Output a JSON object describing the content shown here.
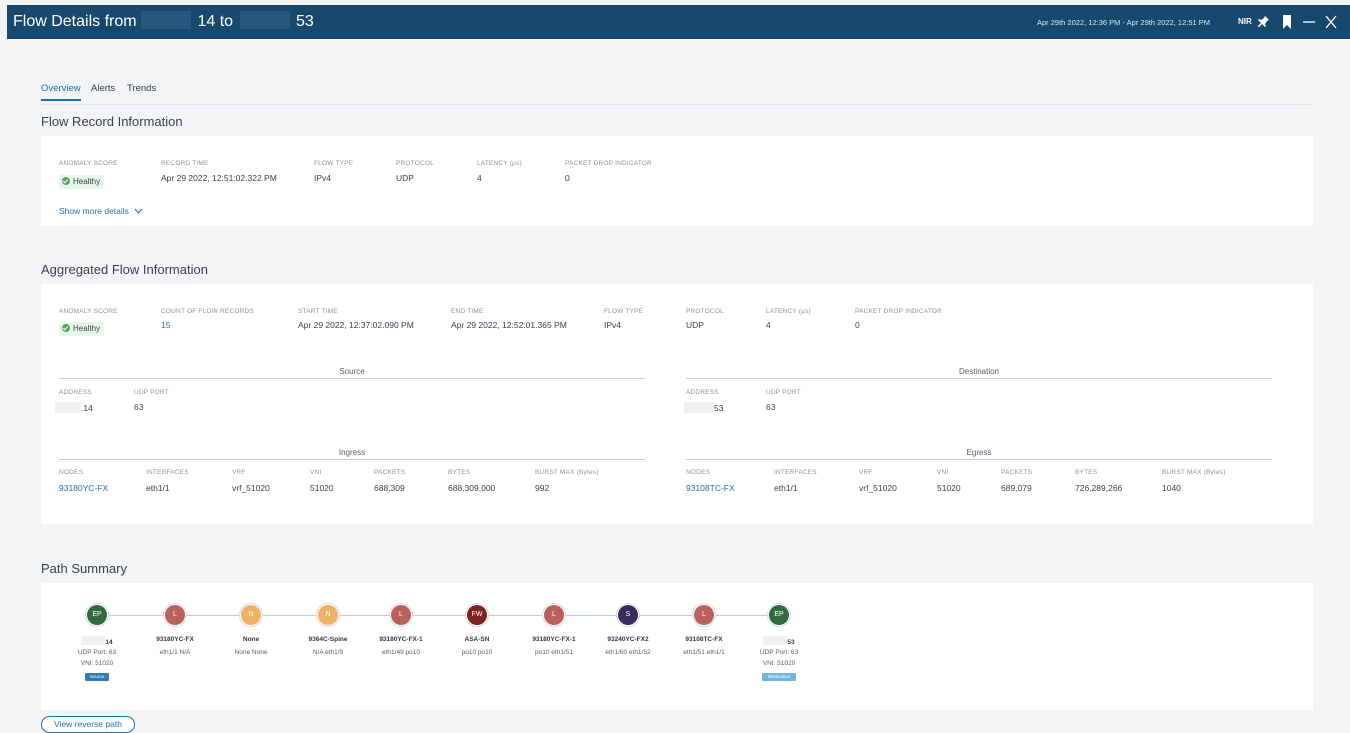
{
  "header": {
    "title_prefix": "Flow Details from",
    "src_suffix": "14 to",
    "dst_suffix": "53",
    "time_range": "Apr 29th 2022, 12:36 PM - Apr 29th 2022, 12:51 PM",
    "site": "NIR",
    "icons": [
      "pin-icon",
      "bookmark-icon",
      "minimize-icon",
      "close-icon"
    ]
  },
  "tabs": [
    "Overview",
    "Alerts",
    "Trends"
  ],
  "flow_record": {
    "title": "Flow Record Information",
    "labels": {
      "anomaly": "ANOMALY SCORE",
      "record_time": "RECORD TIME",
      "flow_type": "FLOW TYPE",
      "protocol": "PROTOCOL",
      "latency": "LATENCY (µs)",
      "drop": "PACKET DROP INDICATOR"
    },
    "values": {
      "anomaly": "Healthy",
      "record_time": "Apr 29 2022, 12:51:02.322 PM",
      "flow_type": "IPv4",
      "protocol": "UDP",
      "latency": "4",
      "drop": "0"
    },
    "show_more": "Show more details"
  },
  "aggregated": {
    "title": "Aggregated Flow Information",
    "labels": {
      "anomaly": "ANOMALY SCORE",
      "count": "COUNT OF FLOW RECORDS",
      "start": "START TIME",
      "end": "END TIME",
      "flow_type": "FLOW TYPE",
      "protocol": "PROTOCOL",
      "latency": "LATENCY (µs)",
      "drop": "PACKET DROP INDICATOR"
    },
    "values": {
      "anomaly": "Healthy",
      "count": "15",
      "start": "Apr 29 2022, 12:37:02.090 PM",
      "end": "Apr 29 2022, 12:52:01.365 PM",
      "flow_type": "IPv4",
      "protocol": "UDP",
      "latency": "4",
      "drop": "0"
    },
    "source": {
      "title": "Source",
      "address_label": "ADDRESS",
      "port_label": "UDP PORT",
      "address": ".14",
      "port": "63"
    },
    "destination": {
      "title": "Destination",
      "address_label": "ADDRESS",
      "port_label": "UDP PORT",
      "address": "53",
      "port": "63"
    },
    "ingress": {
      "title": "Ingress",
      "headers": [
        "NODES",
        "INTERFACES",
        "VRF",
        "VNI",
        "PACKETS",
        "BYTES",
        "BURST MAX (Bytes)"
      ],
      "row": [
        "93180YC-FX",
        "eth1/1",
        "vrf_51020",
        "51020",
        "688,309",
        "688,309,000",
        "992"
      ]
    },
    "egress": {
      "title": "Egress",
      "headers": [
        "NODES",
        "INTERFACES",
        "VRF",
        "VNI",
        "PACKETS",
        "BYTES",
        "BURST MAX (Bytes)"
      ],
      "row": [
        "93108TC-FX",
        "eth1/1",
        "vrf_51020",
        "51020",
        "689,079",
        "726,289,266",
        "1040"
      ]
    }
  },
  "path": {
    "title": "Path Summary",
    "nodes": [
      {
        "letter": "EP",
        "color": "#2f6b3f",
        "name": "14",
        "sub": "UDP Port: 63",
        "sub2": "VNI: 51020",
        "tag": "Source"
      },
      {
        "letter": "L",
        "color": "#b9615f",
        "name": "93180YC-FX",
        "sub": "eth1/1 N/A"
      },
      {
        "letter": "N",
        "color": "#eeb266",
        "name": "None",
        "sub": "None None"
      },
      {
        "letter": "N",
        "color": "#eeb266",
        "name": "9364C-Spine",
        "sub": "N/A eth1/9"
      },
      {
        "letter": "L",
        "color": "#b9615f",
        "name": "93180YC-FX-1",
        "sub": "eth1/49 po10"
      },
      {
        "letter": "FW",
        "color": "#7e2320",
        "name": "ASA-SN",
        "sub": "po10 po10"
      },
      {
        "letter": "L",
        "color": "#b9615f",
        "name": "93180YC-FX-1",
        "sub": "po10 eth1/51"
      },
      {
        "letter": "S",
        "color": "#3b2c5e",
        "name": "93240YC-FX2",
        "sub": "eth1/60 eth1/52"
      },
      {
        "letter": "L",
        "color": "#b9615f",
        "name": "93108TC-FX",
        "sub": "eth1/51 eth1/1"
      },
      {
        "letter": "EP",
        "color": "#2f6b3f",
        "name": "53",
        "sub": "UDP Port: 63",
        "sub2": "VNI: 51020",
        "tag": "Destination"
      }
    ],
    "reverse_button": "View reverse path"
  },
  "colors": {
    "header_bg": "#17496f",
    "accent": "#1f6fa5",
    "healthy": "#52a55b",
    "source_tag": "#2f7bb8",
    "destination_tag": "#6fb6de"
  }
}
